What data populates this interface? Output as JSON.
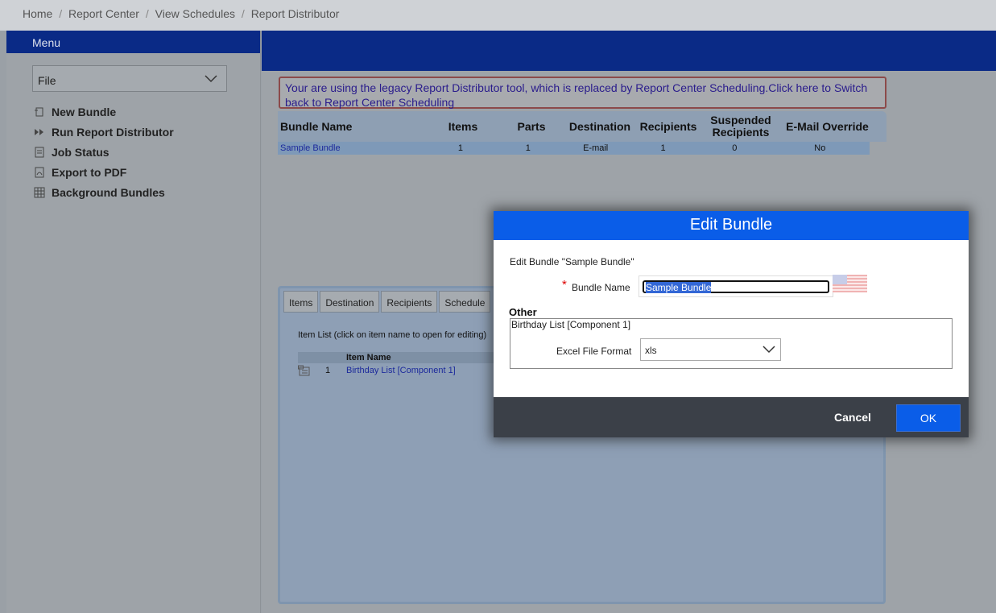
{
  "breadcrumb": [
    "Home",
    "Report Center",
    "View Schedules",
    "Report Distributor"
  ],
  "breadcrumb_separator": "/",
  "sidebar": {
    "menu_title": "Menu",
    "file_select": "File",
    "items": [
      {
        "label": "New Bundle",
        "icon": "new-bundle-icon"
      },
      {
        "label": "Run Report Distributor",
        "icon": "fast-forward-icon"
      },
      {
        "label": "Job Status",
        "icon": "job-status-icon"
      },
      {
        "label": "Export to PDF",
        "icon": "pdf-icon"
      },
      {
        "label": "Background Bundles",
        "icon": "grid-icon"
      }
    ]
  },
  "main": {
    "legacy_notice": "Your are using the legacy Report Distributor tool, which is replaced by Report Center Scheduling.Click here to Switch back to Report Center Scheduling",
    "bundle_table": {
      "headers": [
        "Bundle Name",
        "Items",
        "Parts",
        "Destination",
        "Recipients",
        "Suspended Recipients",
        "E-Mail Override"
      ],
      "rows": [
        [
          "Sample Bundle",
          "1",
          "1",
          "E-mail",
          "1",
          "0",
          "No"
        ]
      ]
    },
    "tabs": [
      "Items",
      "Destination",
      "Recipients",
      "Schedule"
    ],
    "item_list_label": "Item List (click on item name to open for editing)",
    "item_table": {
      "header": "Item Name",
      "rows": [
        {
          "num": "1",
          "name": "Birthday List [Component 1]"
        }
      ]
    }
  },
  "dialog": {
    "title": "Edit Bundle",
    "subtitle": "Edit Bundle \"Sample Bundle\"",
    "required_mark": "*",
    "bundle_name_label": "Bundle Name",
    "bundle_name_value": "Sample Bundle",
    "other_label": "Other",
    "other_item": "Birthday List [Component 1]",
    "excel_format_label": "Excel File Format",
    "excel_format_value": "xls",
    "cancel": "Cancel",
    "ok": "OK"
  },
  "colors": {
    "navy": "#0a2a86",
    "dialog_blue": "#0a5de8",
    "link": "#1c2a9c"
  }
}
